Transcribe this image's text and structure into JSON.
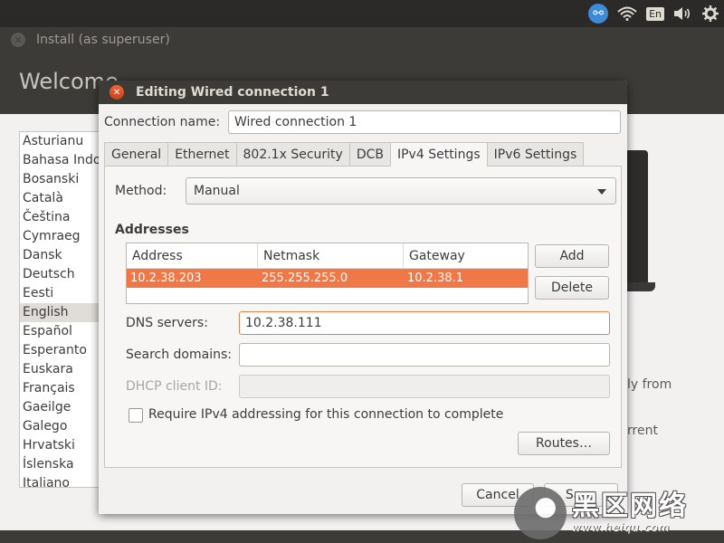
{
  "top_panel": {
    "language_indicator": "En",
    "icons": [
      "accessibility-icon",
      "wifi-icon",
      "volume-icon",
      "gear-icon"
    ]
  },
  "installer": {
    "title": "Install (as superuser)",
    "heading": "Welcome",
    "languages": [
      "Asturianu",
      "Bahasa Indo",
      "Bosanski",
      "Català",
      "Čeština",
      "Cymraeg",
      "Dansk",
      "Deutsch",
      "Eesti",
      "English",
      "Español",
      "Esperanto",
      "Euskara",
      "Français",
      "Gaeilge",
      "Galego",
      "Hrvatski",
      "Íslenska",
      "Italiano"
    ],
    "selected_language": "English",
    "partial_text_1": "ly from",
    "partial_text_2": "rrent"
  },
  "dialog": {
    "title": "Editing Wired connection 1",
    "connection_name_label": "Connection name:",
    "connection_name_value": "Wired connection 1",
    "tabs": [
      {
        "label": "General"
      },
      {
        "label": "Ethernet"
      },
      {
        "label": "802.1x Security"
      },
      {
        "label": "DCB"
      },
      {
        "label": "IPv4 Settings"
      },
      {
        "label": "IPv6 Settings"
      }
    ],
    "active_tab": "IPv4 Settings",
    "method_label": "Method:",
    "method_value": "Manual",
    "addresses_heading": "Addresses",
    "columns": [
      "Address",
      "Netmask",
      "Gateway"
    ],
    "rows": [
      {
        "address": "10.2.38.203",
        "netmask": "255.255.255.0",
        "gateway": "10.2.38.1"
      }
    ],
    "add_label": "Add",
    "delete_label": "Delete",
    "dns_label": "DNS servers:",
    "dns_value": "10.2.38.111",
    "search_label": "Search domains:",
    "search_value": "",
    "dhcp_label": "DHCP client ID:",
    "dhcp_value": "",
    "require_ipv4_label": "Require IPv4 addressing for this connection to complete",
    "require_ipv4_checked": false,
    "routes_label": "Routes…",
    "cancel_label": "Cancel",
    "save_label": "Save"
  },
  "watermark": {
    "chinese": "黑区网络",
    "url": "www.heiqu.com"
  },
  "colors": {
    "accent": "#f07746",
    "panel": "#2b2a28",
    "titlebar": "#3c3b37"
  }
}
